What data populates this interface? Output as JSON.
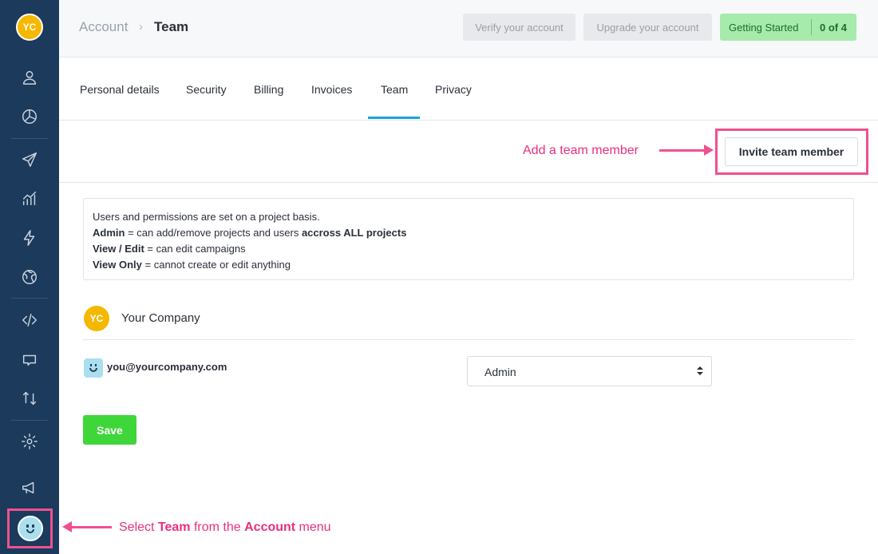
{
  "sidebar": {
    "avatar_initials": "YC",
    "icons": [
      "user-icon",
      "pie-chart-icon",
      "paper-plane-icon",
      "analytics-icon",
      "lightning-icon",
      "globe-icon",
      "code-icon",
      "chat-icon",
      "sort-icon",
      "gear-icon",
      "megaphone-icon",
      "user-face-icon"
    ]
  },
  "header": {
    "breadcrumb": {
      "account": "Account",
      "separator": "›",
      "current": "Team"
    },
    "verify_label": "Verify your account",
    "upgrade_label": "Upgrade your account",
    "getting_started": {
      "label": "Getting Started",
      "count": "0 of 4"
    }
  },
  "tabs": [
    {
      "label": "Personal details"
    },
    {
      "label": "Security"
    },
    {
      "label": "Billing"
    },
    {
      "label": "Invoices"
    },
    {
      "label": "Team",
      "active": true
    },
    {
      "label": "Privacy"
    }
  ],
  "invite": {
    "annotation": "Add a team member",
    "button_label": "Invite team member"
  },
  "info": {
    "line1": "Users and permissions are set on a project basis.",
    "admin_term": "Admin",
    "admin_desc": " = can add/remove projects and users ",
    "admin_emph": "accross ALL projects",
    "view_edit_term": "View / Edit",
    "view_edit_desc": " = can edit campaigns",
    "view_only_term": "View Only",
    "view_only_desc": " = cannot create or edit anything"
  },
  "company": {
    "initials": "YC",
    "name": "Your Company"
  },
  "member": {
    "email": "you@yourcompany.com",
    "role": "Admin"
  },
  "save_label": "Save",
  "bottom_annotation": {
    "prefix": "Select ",
    "team": "Team",
    "middle": " from the ",
    "account": "Account",
    "suffix": " menu"
  },
  "colors": {
    "sidebar_bg": "#1b3a5c",
    "annotation": "#e8307e",
    "tab_active": "#1aa4d8",
    "save_bg": "#3fd63a",
    "getting_started_bg": "#a6ebab",
    "avatar_bg": "#f5b800"
  }
}
